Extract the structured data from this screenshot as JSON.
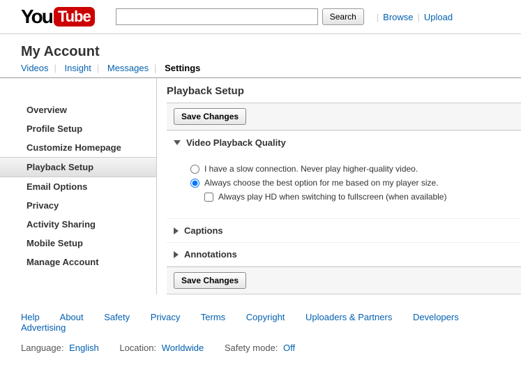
{
  "header": {
    "search_button": "Search",
    "browse": "Browse",
    "upload": "Upload"
  },
  "page_title": "My Account",
  "tabs": {
    "videos": "Videos",
    "insight": "Insight",
    "messages": "Messages",
    "settings": "Settings"
  },
  "sidebar": {
    "items": [
      "Overview",
      "Profile Setup",
      "Customize Homepage",
      "Playback Setup",
      "Email Options",
      "Privacy",
      "Activity Sharing",
      "Mobile Setup",
      "Manage Account"
    ]
  },
  "main": {
    "title": "Playback Setup",
    "save": "Save Changes",
    "quality": {
      "title": "Video Playback Quality",
      "opt_slow": "I have a slow connection. Never play higher-quality video.",
      "opt_auto": "Always choose the best option for me based on my player size.",
      "opt_hd": "Always play HD when switching to fullscreen (when available)"
    },
    "captions": "Captions",
    "annotations": "Annotations"
  },
  "footer": {
    "links": [
      "Help",
      "About",
      "Safety",
      "Privacy",
      "Terms",
      "Copyright",
      "Uploaders & Partners",
      "Developers",
      "Advertising"
    ],
    "language_lbl": "Language:",
    "language_val": "English",
    "location_lbl": "Location:",
    "location_val": "Worldwide",
    "safety_lbl": "Safety mode:",
    "safety_val": "Off"
  }
}
